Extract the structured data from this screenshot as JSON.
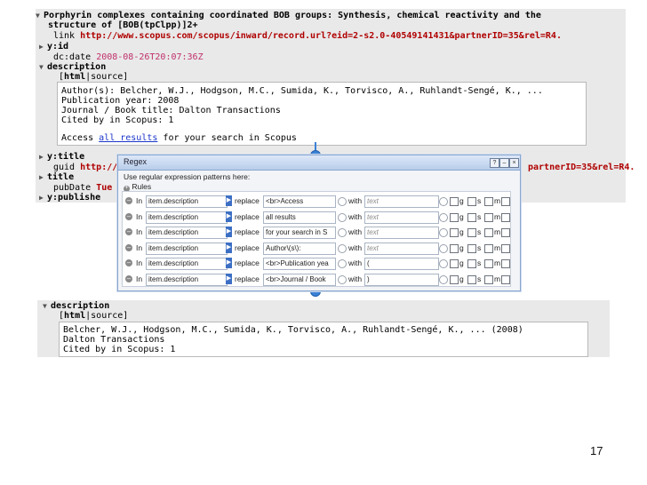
{
  "top": {
    "title_line1": "Porphyrin complexes containing coordinated BOB groups: Synthesis, chemical reactivity and the",
    "title_line2": "structure of [BOB(tpClpp)]2+",
    "link_key": "link",
    "link_value": "http://www.scopus.com/scopus/inward/record.url?eid=2-s2.0-40549141431&partnerID=35&rel=R4.",
    "yid": "y:id",
    "dcdate_key": "dc:date",
    "dcdate_value": "2008-08-26T20:07:36Z",
    "description_key": "description",
    "html_tab": "html",
    "source_tab": "source",
    "desc_lines": [
      "Author(s): Belcher, W.J., Hodgson, M.C., Sumida, K., Torvisco, A., Ruhlandt-Sengé, K., ...",
      "Publication year: 2008",
      "Journal / Book title: Dalton Transactions",
      "Cited by in Scopus: 1"
    ],
    "access_prefix": "Access",
    "access_link": "all results",
    "access_suffix": "for your search in Scopus",
    "ytitle": "y:title",
    "guid_key": "guid",
    "guid_value": "http://",
    "guid_tail": "partnerID=35&rel=R4.",
    "title_key": "title",
    "pubdate_key": "pubDate",
    "pubdate_value": "Tue",
    "ypublished": "y:publishe"
  },
  "regex": {
    "window_title": "Regex",
    "intro": "Use regular expression patterns here:",
    "rules_label": "Rules",
    "rows": [
      {
        "in": "In",
        "field": "item.description",
        "replace": "replace",
        "pattern": "<br>Access",
        "with": "with",
        "value": "text",
        "value_placeholder": true
      },
      {
        "in": "In",
        "field": "item.description",
        "replace": "replace",
        "pattern": "all results",
        "with": "with",
        "value": "text",
        "value_placeholder": true
      },
      {
        "in": "In",
        "field": "item.description",
        "replace": "replace",
        "pattern": "for your search in S",
        "with": "with",
        "value": "text",
        "value_placeholder": true
      },
      {
        "in": "In",
        "field": "item.description",
        "replace": "replace",
        "pattern": "Author\\(s\\):",
        "with": "with",
        "value": "text",
        "value_placeholder": true
      },
      {
        "in": "In",
        "field": "item.description",
        "replace": "replace",
        "pattern": "<br>Publication yea",
        "with": "with",
        "value": "(",
        "value_placeholder": false
      },
      {
        "in": "In",
        "field": "item.description",
        "replace": "replace",
        "pattern": "<br>Journal / Book",
        "with": "with",
        "value": ")",
        "value_placeholder": false
      }
    ],
    "flags": [
      "g",
      "s",
      "m"
    ]
  },
  "bottom": {
    "description_key": "description",
    "html_tab": "html",
    "source_tab": "source",
    "desc_lines": [
      "Belcher, W.J., Hodgson, M.C., Sumida, K., Torvisco, A., Ruhlandt-Sengé, K., ... (2008)",
      "Dalton Transactions",
      "Cited by in Scopus: 1"
    ]
  },
  "page_number": "17"
}
